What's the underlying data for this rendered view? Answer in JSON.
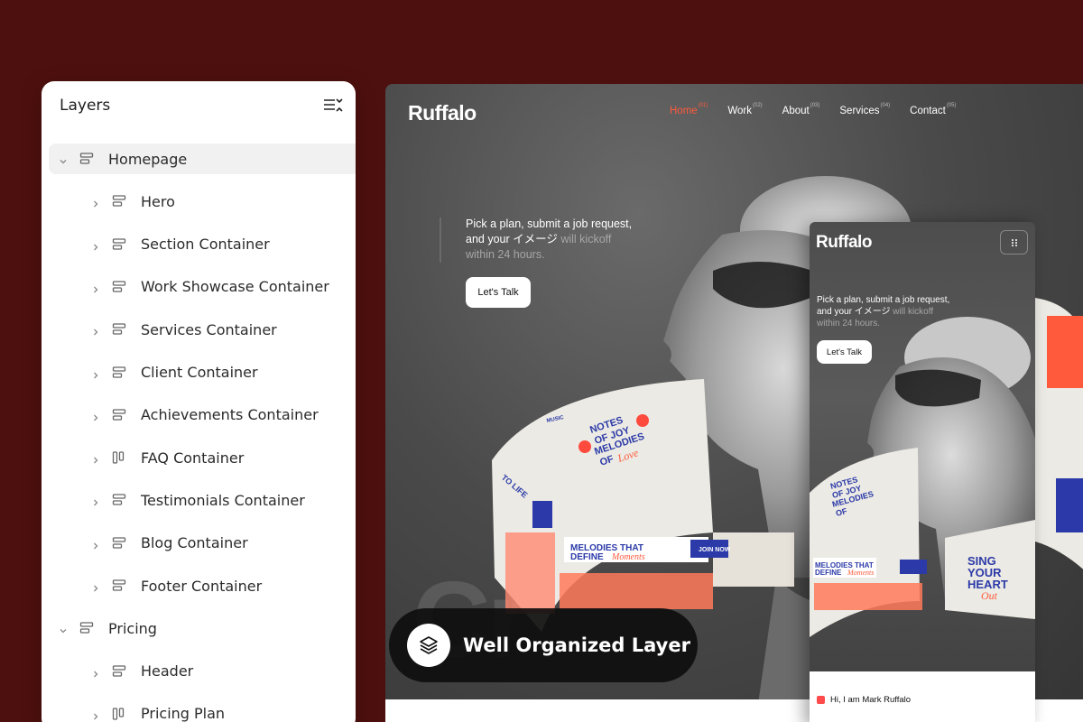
{
  "layers_panel": {
    "title": "Layers",
    "items": [
      {
        "label": "Homepage",
        "level": 0,
        "icon": "section-icon",
        "selected": true
      },
      {
        "label": "Hero",
        "level": 1,
        "icon": "section-icon"
      },
      {
        "label": "Section Container",
        "level": 1,
        "icon": "section-icon"
      },
      {
        "label": "Work Showcase Container",
        "level": 1,
        "icon": "section-icon"
      },
      {
        "label": "Services Container",
        "level": 1,
        "icon": "section-icon"
      },
      {
        "label": "Client Container",
        "level": 1,
        "icon": "section-icon"
      },
      {
        "label": "Achievements Container",
        "level": 1,
        "icon": "section-icon"
      },
      {
        "label": "FAQ Container",
        "level": 1,
        "icon": "columns-icon"
      },
      {
        "label": "Testimonials Container",
        "level": 1,
        "icon": "section-icon"
      },
      {
        "label": "Blog Container",
        "level": 1,
        "icon": "section-icon"
      },
      {
        "label": "Footer Container",
        "level": 1,
        "icon": "section-icon"
      },
      {
        "label": "Pricing",
        "level": 0,
        "icon": "section-icon"
      },
      {
        "label": "Header",
        "level": 1,
        "icon": "section-icon"
      },
      {
        "label": "Pricing Plan",
        "level": 1,
        "icon": "columns-icon"
      }
    ]
  },
  "desktop": {
    "logo": "Ruffalo",
    "nav": [
      {
        "label": "Home",
        "num": "(01)",
        "active": true
      },
      {
        "label": "Work",
        "num": "(02)"
      },
      {
        "label": "About",
        "num": "(03)"
      },
      {
        "label": "Services",
        "num": "(04)"
      },
      {
        "label": "Contact",
        "num": "(05)"
      }
    ],
    "hero": {
      "line1": "Pick a plan, submit a job request,",
      "line2_main": "and your イメージ",
      "line2_muted": " will kickoff",
      "line3_muted": "within 24 hours.",
      "cta": "Let's Talk"
    },
    "big_word": "Cr"
  },
  "poster": {
    "notes": [
      "NOTES",
      "OF JOY",
      "MELODIES",
      "OF"
    ],
    "love": "Love",
    "melodies": "MELODIES THAT",
    "define": "DEFINE",
    "moments": "Moments",
    "join": "JOIN NOW",
    "sing": [
      "SING",
      "YOUR",
      "HEART"
    ],
    "out": "Out",
    "music": "MUSIC",
    "life": "TO LIFE"
  },
  "badge": {
    "text": "Well Organized Layer",
    "icon": "layers-icon"
  },
  "mobile": {
    "logo": "Ruffalo",
    "hero": {
      "line1": "Pick a plan, submit a job request,",
      "line2_main": "and your イメージ",
      "line2_muted": " will kickoff",
      "line3_muted": "within 24 hours.",
      "cta": "Let's Talk"
    },
    "intro": "Hi, I am Mark Ruffalo"
  },
  "colors": {
    "background": "#4e100e",
    "accent": "#ff5a3c",
    "poster_blue": "#2b3aa8",
    "poster_red": "#ff4b3e"
  }
}
